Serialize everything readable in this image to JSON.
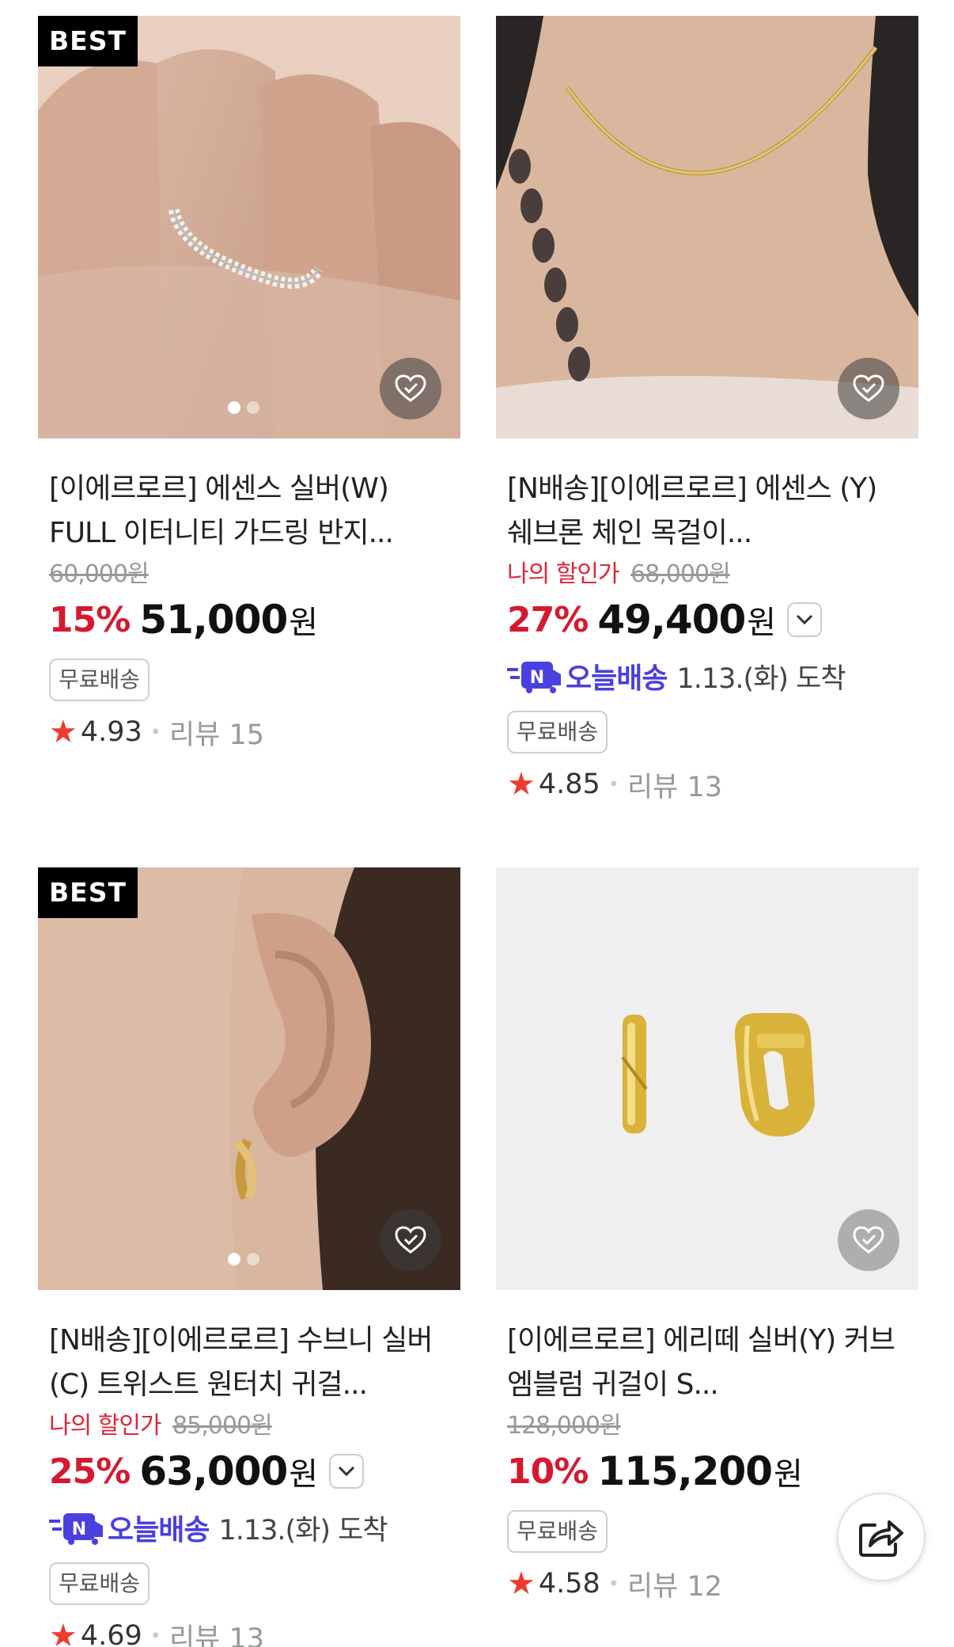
{
  "products": [
    {
      "badge": "BEST",
      "title": "[이에르로르] 에센스 실버(W) FULL 이터니티 가드링 반지...",
      "my_price_label": "",
      "original_price": "60,000원",
      "discount_rate": "15%",
      "price": "51,000",
      "currency": "원",
      "delivery_brand": "",
      "delivery_text": "",
      "free_shipping": "무료배송",
      "rating": "4.93",
      "reviews": "리뷰 15"
    },
    {
      "badge": "",
      "title": "[N배송][이에르로르] 에센스 (Y) 쉐브론 체인 목걸이...",
      "my_price_label": "나의 할인가",
      "original_price": "68,000원",
      "discount_rate": "27%",
      "price": "49,400",
      "currency": "원",
      "delivery_brand": "오늘배송",
      "delivery_text": "1.13.(화) 도착",
      "free_shipping": "무료배송",
      "rating": "4.85",
      "reviews": "리뷰 13"
    },
    {
      "badge": "BEST",
      "title": "[N배송][이에르로르] 수브니 실버(C) 트위스트 원터치 귀걸...",
      "my_price_label": "나의 할인가",
      "original_price": "85,000원",
      "discount_rate": "25%",
      "price": "63,000",
      "currency": "원",
      "delivery_brand": "오늘배송",
      "delivery_text": "1.13.(화) 도착",
      "free_shipping": "무료배송",
      "rating": "4.69",
      "reviews": "리뷰 13"
    },
    {
      "badge": "",
      "title": "[이에르로르] 에리떼 실버(Y) 커브엠블럼 귀걸이 S...",
      "my_price_label": "",
      "original_price": "128,000원",
      "discount_rate": "10%",
      "price": "115,200",
      "currency": "원",
      "delivery_brand": "",
      "delivery_text": "",
      "free_shipping": "무료배송",
      "rating": "4.58",
      "reviews": "리뷰 12"
    }
  ],
  "colors": {
    "discount": "#d6192f",
    "my_price": "#e0243a",
    "today_delivery": "#4a3fe0",
    "star": "#ef3b2d"
  },
  "icons": {
    "like": "heart-check-icon",
    "star": "star-icon",
    "expand": "chevron-down-icon",
    "delivery": "n-delivery-icon",
    "share": "share-icon"
  }
}
